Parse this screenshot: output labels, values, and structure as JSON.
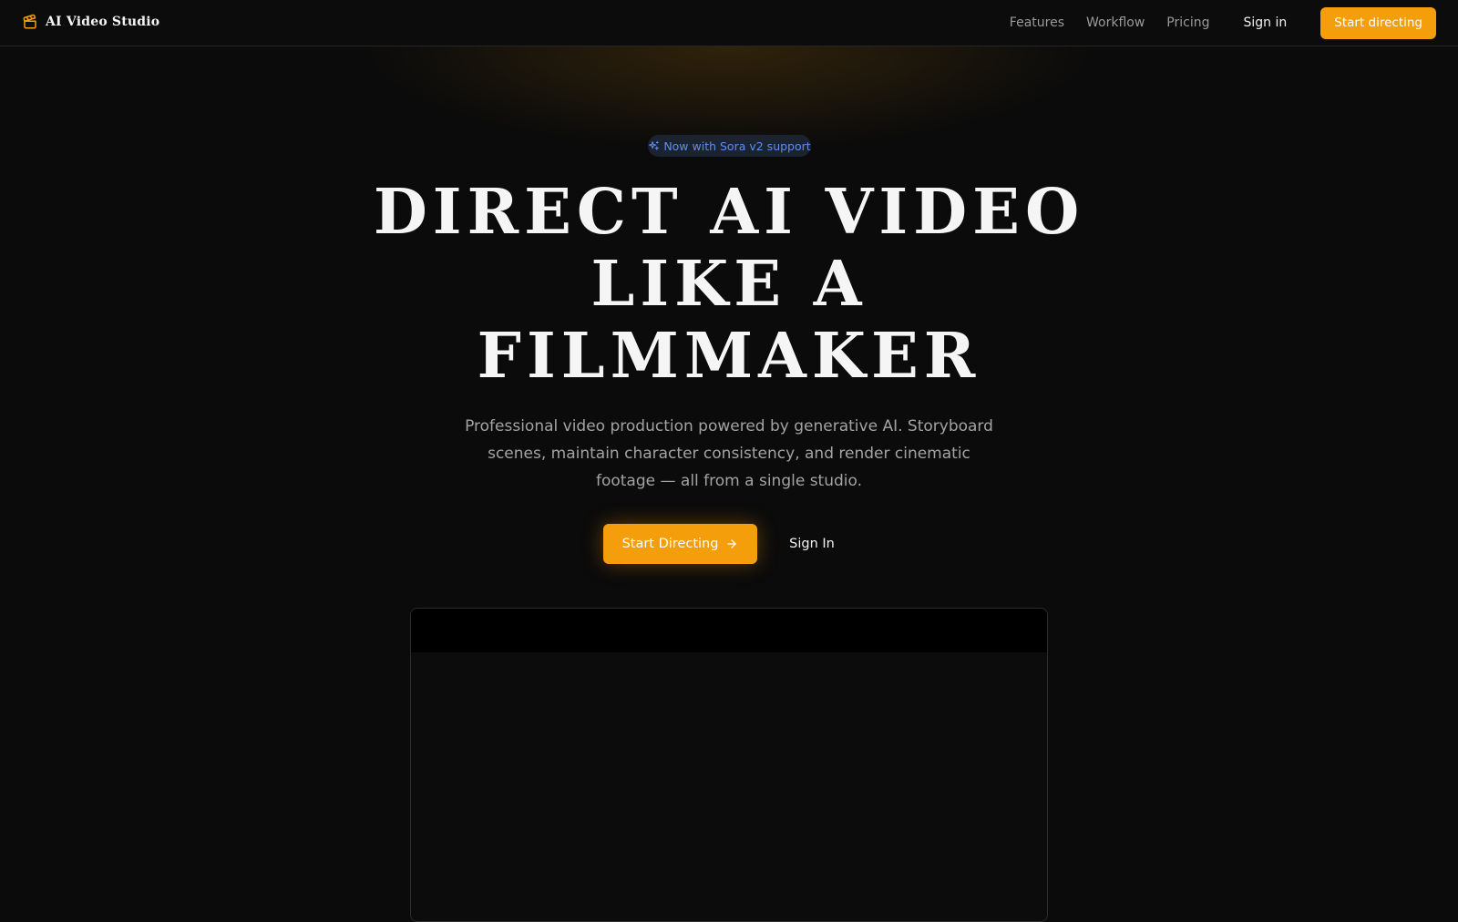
{
  "brand": {
    "name": "AI Video Studio",
    "icon": "clapperboard-icon",
    "accent_color": "#f59e0b"
  },
  "nav": {
    "links": [
      {
        "label": "Features"
      },
      {
        "label": "Workflow"
      },
      {
        "label": "Pricing"
      }
    ],
    "signin_label": "Sign in",
    "cta_label": "Start directing"
  },
  "hero": {
    "badge": {
      "icon": "sparkles-icon",
      "text": "Now with Sora v2 support",
      "color": "#5b8ef0"
    },
    "headline_lines": [
      "DIRECT AI VIDEO",
      "LIKE A",
      "FILMMAKER"
    ],
    "subtitle": "Professional video production powered by generative AI. Storyboard scenes, maintain character consistency, and render cinematic footage — all from a single studio.",
    "primary_cta": {
      "label": "Start Directing",
      "icon": "arrow-right-icon"
    },
    "secondary_cta": {
      "label": "Sign In"
    }
  },
  "colors": {
    "background": "#0b0b0b",
    "accent": "#f59e0b",
    "muted_text": "#a3a3a3"
  }
}
